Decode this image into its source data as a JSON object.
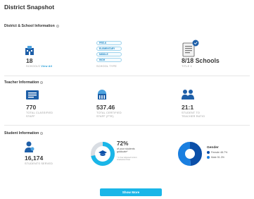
{
  "page": {
    "title": "District Snapshot"
  },
  "district": {
    "section_title": "District & School Information",
    "schools_count": "18",
    "schools_caption": "SCHOOLS",
    "view_all": "View All",
    "school_types": [
      "PRE-K",
      "ELEMENTARY",
      "MIDDLE",
      "HIGH"
    ],
    "school_type_caption": "SCHOOL TYPE",
    "title1_value": "8/18 Schools",
    "title1_caption": "TITLE 1"
  },
  "teacher": {
    "section_title": "Teacher Information",
    "classified_value": "770",
    "classified_caption_1": "TOTAL CLASSIFIED",
    "classified_caption_2": "STAFF",
    "certified_value": "537.46",
    "certified_caption_1": "TOTAL CERTIFIED",
    "certified_caption_2": "STAFF (FTE)",
    "ratio_value": "21:1",
    "ratio_caption_1": "STUDENT TO",
    "ratio_caption_2": "TEACHER RATIO"
  },
  "student": {
    "section_title": "Student Information",
    "students_value": "16,174",
    "students_caption": "STUDENTS SERVED",
    "grad_percent": "72%",
    "grad_fraction": 0.72,
    "grad_text_1": "of your students",
    "grad_text_2": "graduate",
    "grad_note_1": "* 4-Year Adjusted Cohort",
    "grad_note_2": "Graduation Rate",
    "gender_title": "Gender",
    "gender": [
      {
        "label": "Female 48.7%",
        "value": 48.7,
        "color": "#0b4fa8"
      },
      {
        "label": "Male 51.3%",
        "value": 51.3,
        "color": "#1a7fe0"
      }
    ]
  },
  "actions": {
    "show_more": "Show More"
  },
  "colors": {
    "accent": "#1ab6e8",
    "icon_blue": "#1e5fa8",
    "icon_light": "#4ca3e0"
  },
  "icons": [
    "school-building-icon",
    "certificate-icon",
    "staff-card-icon",
    "graduation-building-icon",
    "teacher-group-icon",
    "student-person-icon",
    "graduation-cap-icon",
    "info-icon"
  ]
}
